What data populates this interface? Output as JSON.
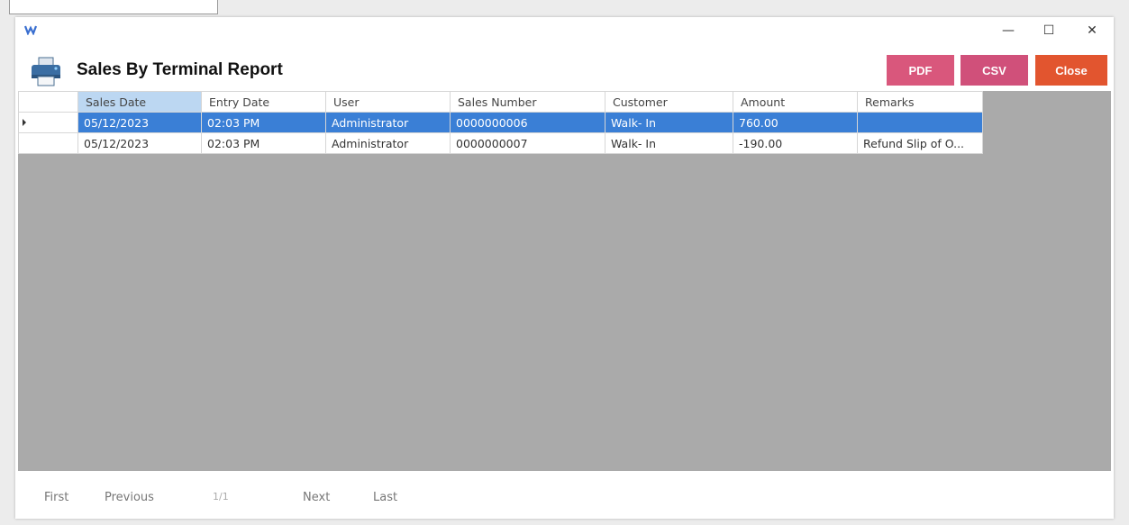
{
  "window": {
    "title": "Sales By Terminal Report",
    "controls": {
      "minimize": "—",
      "maximize": "☐",
      "close": "✕"
    }
  },
  "toolbar": {
    "pdf_label": "PDF",
    "csv_label": "CSV",
    "close_label": "Close"
  },
  "colors": {
    "pdf_button": "#d9577c",
    "csv_button": "#d0507a",
    "close_button": "#e2552f",
    "selected_row": "#3a7fd6",
    "grid_background": "#aaaaaa"
  },
  "table": {
    "columns": [
      "Sales Date",
      "Entry Date",
      "User",
      "Sales Number",
      "Customer",
      "Amount",
      "Remarks"
    ],
    "rows": [
      [
        "05/12/2023",
        "02:03 PM",
        "Administrator",
        "0000000006",
        "Walk- In",
        "760.00",
        ""
      ],
      [
        "05/12/2023",
        "02:03 PM",
        "Administrator",
        "0000000007",
        "Walk- In",
        "-190.00",
        "Refund Slip of O..."
      ]
    ]
  },
  "pager": {
    "first": "First",
    "previous": "Previous",
    "page": "1/1",
    "next": "Next",
    "last": "Last"
  }
}
